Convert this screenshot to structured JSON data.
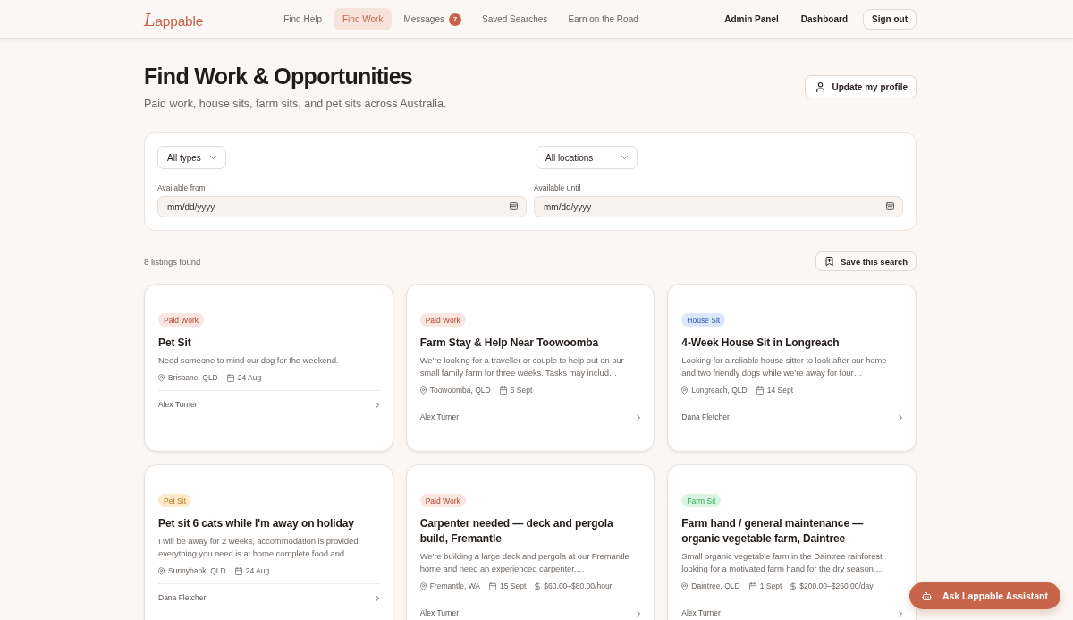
{
  "header": {
    "logo": "Lappable",
    "nav": [
      {
        "label": "Find Help",
        "selected": false
      },
      {
        "label": "Find Work",
        "selected": true
      },
      {
        "label": "Messages",
        "selected": false,
        "badge": "7"
      },
      {
        "label": "Saved Searches",
        "selected": false
      },
      {
        "label": "Earn on the Road",
        "selected": false
      }
    ],
    "links": [
      "Admin Panel",
      "Dashboard"
    ],
    "sign_out": "Sign out"
  },
  "intro": {
    "title": "Find Work & Opportunities",
    "subtitle": "Paid work, house sits, farm sits, and pet sits across Australia.",
    "profile_button": "Update my profile"
  },
  "filters": {
    "type_select": "All types",
    "location_select": "All locations",
    "from": {
      "label": "Available from",
      "placeholder": "mm/dd/yyyy"
    },
    "until": {
      "label": "Available until",
      "placeholder": "mm/dd/yyyy"
    }
  },
  "results": {
    "count": "8 listings found",
    "save_button": "Save this search"
  },
  "listings": [
    {
      "type": "Paid Work",
      "color": "#fbe5e0",
      "title": "Pet Sit",
      "description": "Need someone to mind our dog for the weekend.",
      "location": "Brisbane, QLD",
      "date": "24 Aug",
      "author": "Alex Turner"
    },
    {
      "type": "Paid Work",
      "color": "#fbe5e0",
      "title": "Farm Stay & Help Near Toowoomba",
      "description": "We’re looking for a traveller or couple to help out on our small family farm for three weeks. Tasks may includ…",
      "location": "Toowoomba, QLD",
      "date": "5 Sept",
      "author": "Alex Turner"
    },
    {
      "type": "House Sit",
      "color": "#dde7fb",
      "title": "4-Week House Sit in Longreach",
      "description": "Looking for a reliable house sitter to look after our home and two friendly dogs while we’re away for four…",
      "location": "Longreach, QLD",
      "date": "14 Sept",
      "author": "Dana Fletcher"
    },
    {
      "type": "Pet Sit",
      "color": "#fde9c7",
      "title": "Pet sit 6 cats while I'm away on holiday",
      "description": "I will be away for 2 weeks, accommodation is provided, everything you need is at home complete food and…",
      "location": "Sunnybank, QLD",
      "date": "24 Aug",
      "author": "Dana Fletcher"
    },
    {
      "type": "Paid Work",
      "color": "#fbe5e0",
      "title": "Carpenter needed — deck and pergola build, Fremantle",
      "description": "We’re building a large deck and pergola at our Fremantle home and need an experienced carpenter.…",
      "location": "Fremantle, WA",
      "date": "15 Sept",
      "pay": "$60.00–$80.00/hour",
      "author": "Alex Turner"
    },
    {
      "type": "Farm Sit",
      "color": "#d9f4e3",
      "title": "Farm hand / general maintenance — organic vegetable farm, Daintree",
      "description": "Small organic vegetable farm in the Daintree rainforest looking for a motivated farm hand for the dry season.…",
      "location": "Daintree, QLD",
      "date": "1 Sept",
      "pay": "$200.00–$250.00/day",
      "author": "Alex Turner"
    }
  ],
  "assistant_button": "Ask Lappable Assistant"
}
